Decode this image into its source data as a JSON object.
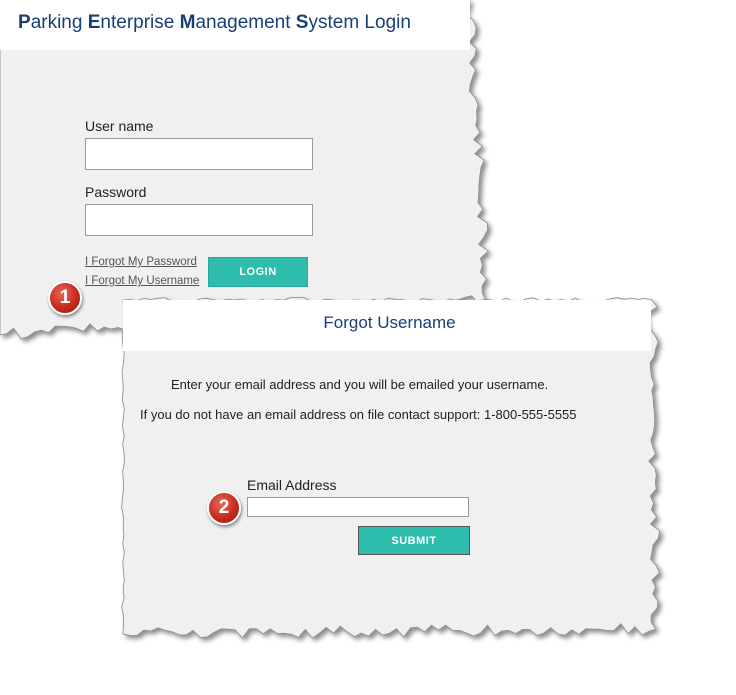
{
  "login": {
    "title_parts": [
      {
        "initial": "P",
        "rest": "arking "
      },
      {
        "initial": "E",
        "rest": "nterprise "
      },
      {
        "initial": "M",
        "rest": "anagement "
      },
      {
        "initial": "S",
        "rest": "ystem Login"
      }
    ],
    "username_label": "User name",
    "username_value": "",
    "password_label": "Password",
    "password_value": "",
    "forgot_password_link": "I Forgot My Password",
    "forgot_username_link": "I Forgot My Username",
    "login_button": "LOGIN"
  },
  "forgot_username": {
    "title": "Forgot Username",
    "instruction": "Enter your email address and you will be emailed your username.",
    "support_text": "If you do not have an email address on file contact support: 1-800-555-5555",
    "email_label": "Email Address",
    "email_value": "",
    "submit_button": "SUBMIT"
  },
  "annotations": {
    "step1": "1",
    "step2": "2"
  },
  "colors": {
    "title_blue": "#1a3f78",
    "button_teal": "#2ebcad",
    "panel_gray": "#f0f0f0",
    "badge_red": "#c62a1f"
  }
}
